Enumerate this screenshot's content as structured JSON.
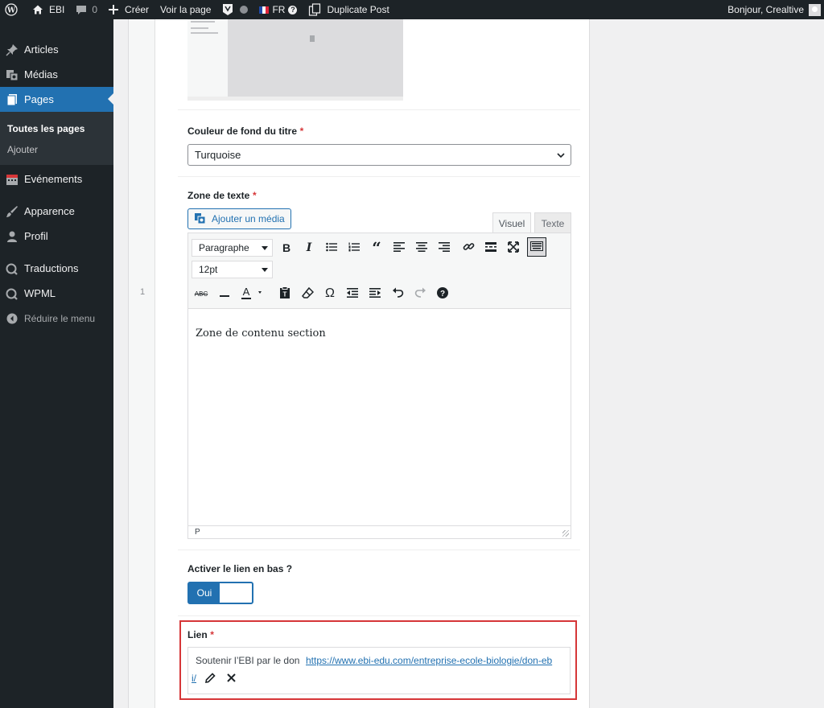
{
  "adminbar": {
    "site_name": "EBI",
    "comments_count": "0",
    "create_label": "Créer",
    "view_page_label": "Voir la page",
    "language_code": "FR",
    "duplicate_label": "Duplicate Post",
    "greeting": "Bonjour, Crealtive",
    "icons": [
      "wordpress-icon",
      "home-icon",
      "comment-icon",
      "plus-icon",
      "yoast-icon",
      "seo-status-dot-icon",
      "flag-fr-icon",
      "help-icon",
      "duplicate-icon",
      "avatar"
    ]
  },
  "sidebar": {
    "items": [
      {
        "label": "Articles",
        "icon": "pin-icon"
      },
      {
        "label": "Médias",
        "icon": "media-icon"
      },
      {
        "label": "Pages",
        "icon": "page-icon"
      },
      {
        "label": "Evénements",
        "icon": "calendar-icon"
      },
      {
        "label": "Apparence",
        "icon": "brush-icon"
      },
      {
        "label": "Profil",
        "icon": "user-icon"
      },
      {
        "label": "Traductions",
        "icon": "translate-icon"
      },
      {
        "label": "WPML",
        "icon": "wpml-icon"
      }
    ],
    "submenu": [
      "Toutes les pages",
      "Ajouter"
    ],
    "collapse_label": "Réduire le menu"
  },
  "editor": {
    "row_number": "1",
    "title_bg": {
      "label": "Couleur de fond du titre",
      "required_mark": "*",
      "value": "Turquoise"
    },
    "text_zone": {
      "label": "Zone de texte",
      "required_mark": "*",
      "add_media_label": "Ajouter un média",
      "tabs": [
        "Visuel",
        "Texte"
      ],
      "format_select": "Paragraphe",
      "font_size_select": "12pt",
      "content": "Zone de contenu section",
      "status_path": "P"
    },
    "bottom_link_toggle": {
      "label": "Activer le lien en bas ?",
      "on_label": "Oui"
    },
    "link": {
      "label": "Lien",
      "required_mark": "*",
      "title": "Soutenir l’EBI par le don",
      "url_line1": "https://www.ebi-edu.com/entreprise-ecole-biologie/don-eb",
      "url_line2": "i/"
    }
  },
  "colors": {
    "adminbar_bg": "#1d2327",
    "accent": "#2271b1",
    "required": "#d63638",
    "highlight_border": "#d63638"
  }
}
